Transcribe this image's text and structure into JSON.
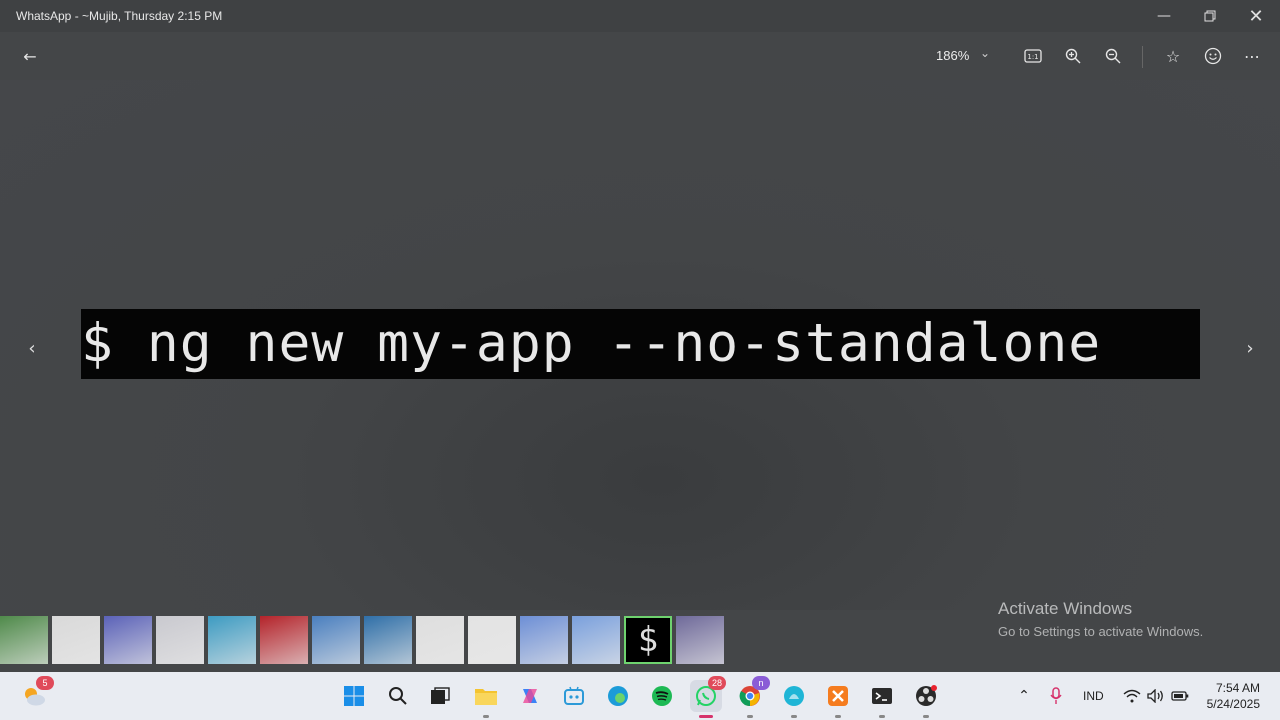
{
  "window": {
    "title": "WhatsApp - ~Mujib, Thursday 2:15 PM",
    "minimize_icon": "minimize-icon",
    "restore_icon": "restore-icon",
    "close_icon": "close-icon"
  },
  "toolbar": {
    "zoom_level": "186%"
  },
  "image": {
    "command": "$ ng new my-app --no-standalone",
    "ghost_line": "  ...  .  ..  .   .. "
  },
  "watermark": {
    "line1": "Activate Windows",
    "line2": "Go to Settings to activate Windows."
  },
  "filmstrip": {
    "thumbs": [
      {
        "color": "#4f8a4a"
      },
      {
        "color": "#d9d9d9"
      },
      {
        "color": "#5b62b8"
      },
      {
        "color": "#c9c9cf"
      },
      {
        "color": "#3d9bc2"
      },
      {
        "color": "#b4232a"
      },
      {
        "color": "#4a7fbf"
      },
      {
        "color": "#2f6fa8"
      },
      {
        "color": "#dedede"
      },
      {
        "color": "#e3e3e3"
      },
      {
        "color": "#6d8fd6"
      },
      {
        "color": "#7aa0dd"
      },
      {
        "color": "#000000",
        "selected": true,
        "glyph": "$"
      },
      {
        "color": "#6f6a9a"
      }
    ]
  },
  "taskbar": {
    "weather_badge": "5",
    "whatsapp_badge": "28",
    "chrome_badge": "n",
    "language": "IND",
    "time": "7:54 AM",
    "date": "5/24/2025"
  }
}
